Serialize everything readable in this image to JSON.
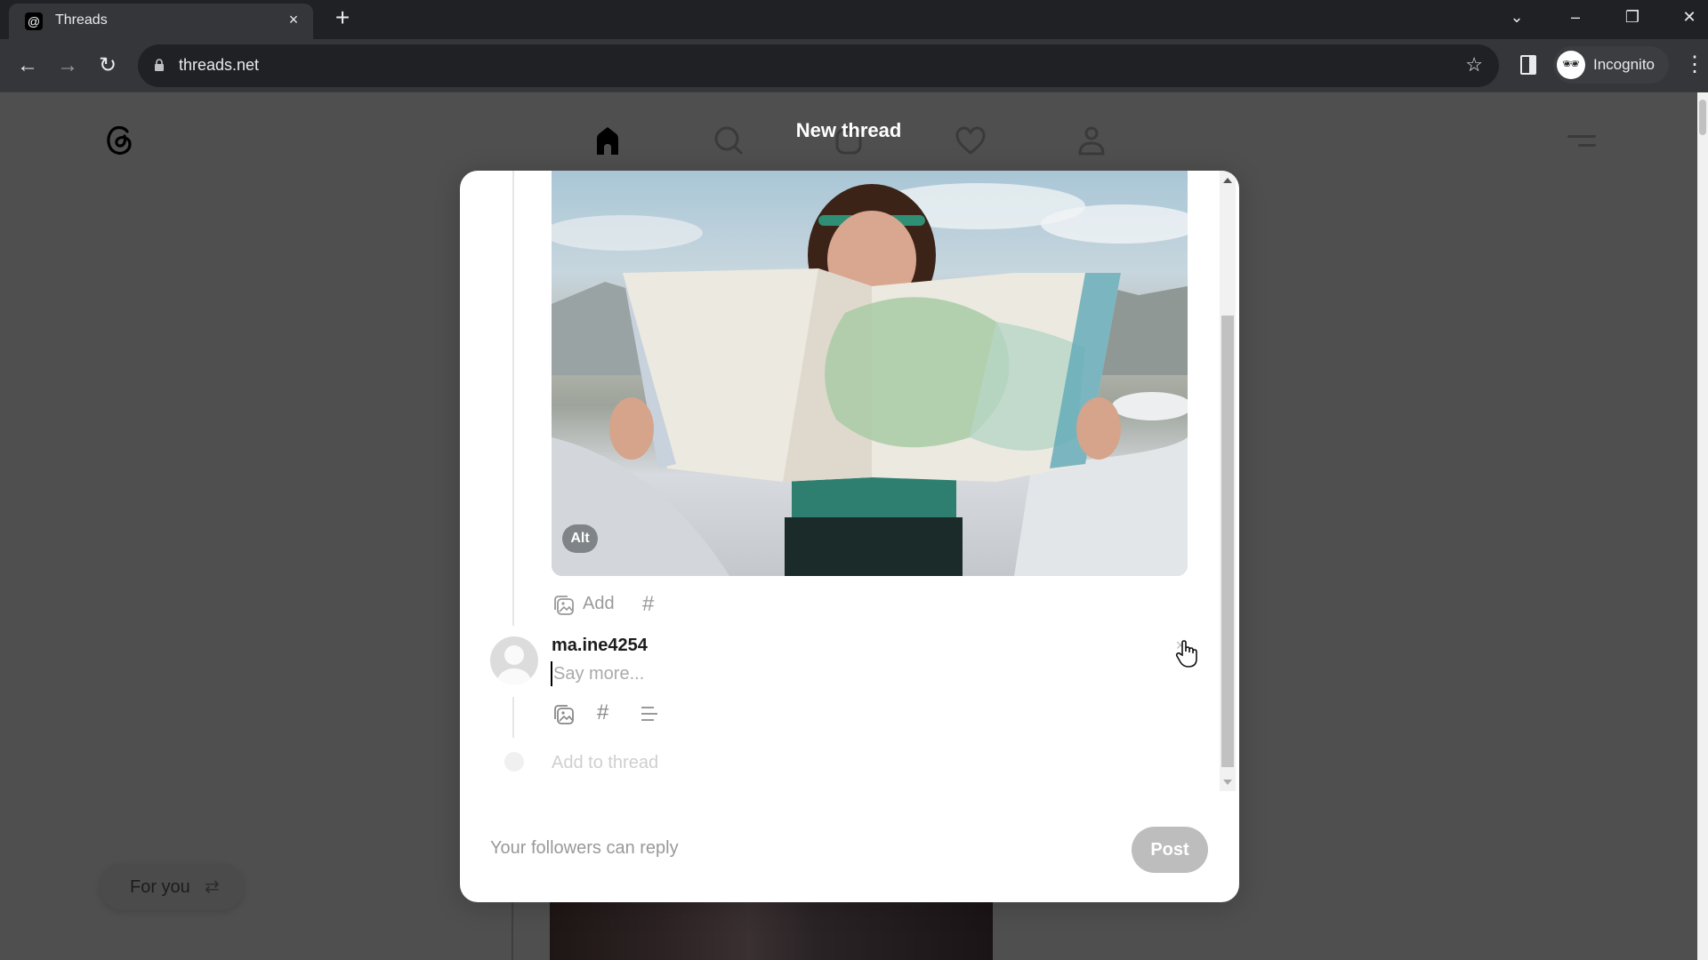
{
  "browser": {
    "tab": {
      "title": "Threads",
      "favicon": "threads-logo-icon",
      "close": "×"
    },
    "new_tab": "+",
    "window_controls": {
      "tab_search": "⌄",
      "minimize": "–",
      "restore": "❐",
      "close": "✕"
    },
    "nav": {
      "back": "←",
      "forward": "→",
      "reload": "↻"
    },
    "url": "threads.net",
    "bookmark_icon": "☆",
    "profile_label": "Incognito",
    "menu": "⋮"
  },
  "page": {
    "nav": {
      "items": [
        "home-icon",
        "search-icon",
        "compose-icon",
        "heart-icon",
        "profile-icon"
      ],
      "active": "home-icon"
    },
    "feed_toggle": {
      "label": "For you",
      "icon": "⇄"
    }
  },
  "modal": {
    "title": "New thread",
    "media": {
      "alt_badge": "Alt",
      "description": "Woman holding a large road map in front of a white car"
    },
    "media_toolbar": {
      "add_label": "Add",
      "hashtag": "#"
    },
    "reply": {
      "username": "ma.ine4254",
      "placeholder": "Say more...",
      "value": "",
      "remove": "×",
      "hashtag": "#"
    },
    "add_to_thread": "Add to thread",
    "footer": {
      "reply_setting": "Your followers can reply",
      "post_label": "Post"
    }
  }
}
